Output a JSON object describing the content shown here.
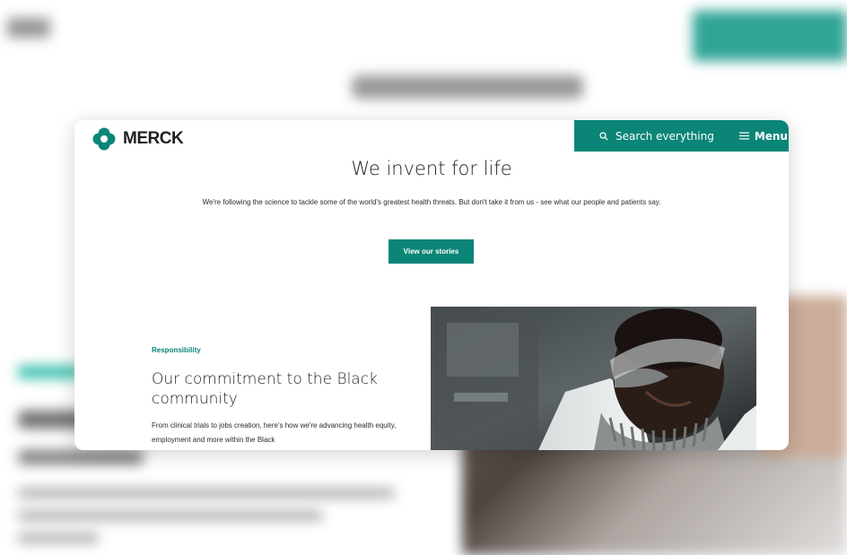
{
  "brand": {
    "name": "MERCK",
    "logo_icon": "merck-logo-icon",
    "color": "#0b8577"
  },
  "header": {
    "search_label": "Search everything",
    "search_icon": "search-icon",
    "menu_label": "Menu",
    "menu_icon": "hamburger-icon"
  },
  "hero": {
    "title": "We invent for life",
    "text": "We're following the science to tackle some of the world's greatest health threats. But don't take it from us - see what our people and patients say.",
    "cta_label": "View our stories"
  },
  "feature": {
    "tag": "Responsibility",
    "title": "Our commitment to the Black community",
    "text": "From clinical trials to jobs creation, here's how we're advancing health equity, employment and more within the Black",
    "image": "scientist-photo"
  }
}
